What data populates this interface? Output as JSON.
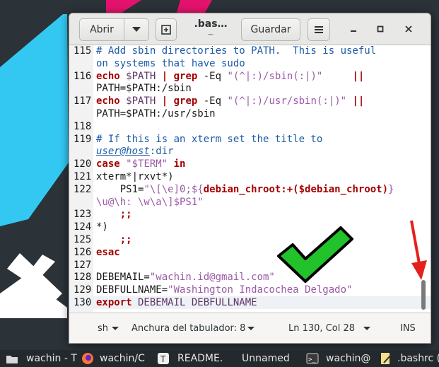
{
  "header": {
    "open_label": "Abrir",
    "title": ".bas…",
    "subtitle": "~",
    "save_label": "Guardar"
  },
  "lines": [
    {
      "n": "115",
      "parts": [
        {
          "t": "# Add sbin directories to PATH.  This is useful",
          "c": "comment"
        }
      ]
    },
    {
      "n": "",
      "parts": [
        {
          "t": "on systems that have sudo",
          "c": "comment"
        }
      ]
    },
    {
      "n": "116",
      "parts": [
        {
          "t": "echo",
          "c": "kw"
        },
        {
          "t": " $PATH ",
          "c": "var"
        },
        {
          "t": "|",
          "c": "kw"
        },
        {
          "t": " ",
          "c": "def"
        },
        {
          "t": "grep",
          "c": "kw"
        },
        {
          "t": " -Eq ",
          "c": "def"
        },
        {
          "t": "\"(^|:)/sbin(:|)\"",
          "c": "str"
        },
        {
          "t": "     ",
          "c": "def"
        },
        {
          "t": "||",
          "c": "kw"
        }
      ]
    },
    {
      "n": "",
      "parts": [
        {
          "t": "PATH=$PATH:/sbin",
          "c": "def"
        }
      ]
    },
    {
      "n": "117",
      "parts": [
        {
          "t": "echo",
          "c": "kw"
        },
        {
          "t": " $PATH ",
          "c": "var"
        },
        {
          "t": "|",
          "c": "kw"
        },
        {
          "t": " ",
          "c": "def"
        },
        {
          "t": "grep",
          "c": "kw"
        },
        {
          "t": " -Eq ",
          "c": "def"
        },
        {
          "t": "\"(^|:)/usr/sbin(:|)\"",
          "c": "str"
        },
        {
          "t": " ",
          "c": "def"
        },
        {
          "t": "||",
          "c": "kw"
        }
      ]
    },
    {
      "n": "",
      "parts": [
        {
          "t": "PATH=$PATH:/usr/sbin",
          "c": "def"
        }
      ]
    },
    {
      "n": "118",
      "parts": []
    },
    {
      "n": "119",
      "parts": [
        {
          "t": "# If this is an xterm set the title to",
          "c": "comment"
        }
      ]
    },
    {
      "n": "",
      "parts": [
        {
          "t": "user@host",
          "c": "under"
        },
        {
          "t": ":dir",
          "c": "comment"
        }
      ]
    },
    {
      "n": "120",
      "parts": [
        {
          "t": "case",
          "c": "kw"
        },
        {
          "t": " ",
          "c": "def"
        },
        {
          "t": "\"$TERM\"",
          "c": "str"
        },
        {
          "t": " ",
          "c": "def"
        },
        {
          "t": "in",
          "c": "kw"
        }
      ]
    },
    {
      "n": "121",
      "parts": [
        {
          "t": "xterm*|rxvt*)",
          "c": "def"
        }
      ]
    },
    {
      "n": "122",
      "parts": [
        {
          "t": "    PS1=",
          "c": "def"
        },
        {
          "t": "\"\\[\\e]0;${",
          "c": "str"
        },
        {
          "t": "debian_chroot:+",
          "c": "kw"
        },
        {
          "t": "($debian_chroot)",
          "c": "kw"
        },
        {
          "t": "}",
          "c": "str"
        }
      ]
    },
    {
      "n": "",
      "parts": [
        {
          "t": "\\u@\\h: \\w\\a\\]$PS1\"",
          "c": "str"
        }
      ]
    },
    {
      "n": "123",
      "parts": [
        {
          "t": "    ;;",
          "c": "kw"
        }
      ]
    },
    {
      "n": "124",
      "parts": [
        {
          "t": "*)",
          "c": "def"
        }
      ]
    },
    {
      "n": "125",
      "parts": [
        {
          "t": "    ;;",
          "c": "kw"
        }
      ]
    },
    {
      "n": "126",
      "parts": [
        {
          "t": "esac",
          "c": "kw"
        }
      ]
    },
    {
      "n": "127",
      "parts": []
    },
    {
      "n": "128",
      "parts": [
        {
          "t": "DEBEMAIL=",
          "c": "def"
        },
        {
          "t": "\"wachin.id@gmail.com\"",
          "c": "str"
        }
      ]
    },
    {
      "n": "129",
      "parts": [
        {
          "t": "DEBFULLNAME=",
          "c": "def"
        },
        {
          "t": "\"Washington Indacochea Delgado\"",
          "c": "str"
        }
      ]
    },
    {
      "n": "130",
      "parts": [
        {
          "t": "export",
          "c": "kw"
        },
        {
          "t": " DEBEMAIL DEBFULLNAME",
          "c": "var"
        }
      ]
    }
  ],
  "status": {
    "language": "sh",
    "tab_width": "Anchura del tabulador: 8",
    "position": "Ln 130, Col 28",
    "mode": "INS"
  },
  "taskbar": [
    {
      "label": "wachin - T",
      "icon": "folder-icon"
    },
    {
      "label": "wachin/C",
      "icon": "firefox-icon"
    },
    {
      "label": "README.",
      "icon": "text-editor-icon"
    },
    {
      "label": "Unnamed",
      "icon": ""
    },
    {
      "label": "wachin@",
      "icon": "terminal-icon"
    },
    {
      "label": ".bashrc (",
      "icon": "text-editor-icon"
    }
  ]
}
